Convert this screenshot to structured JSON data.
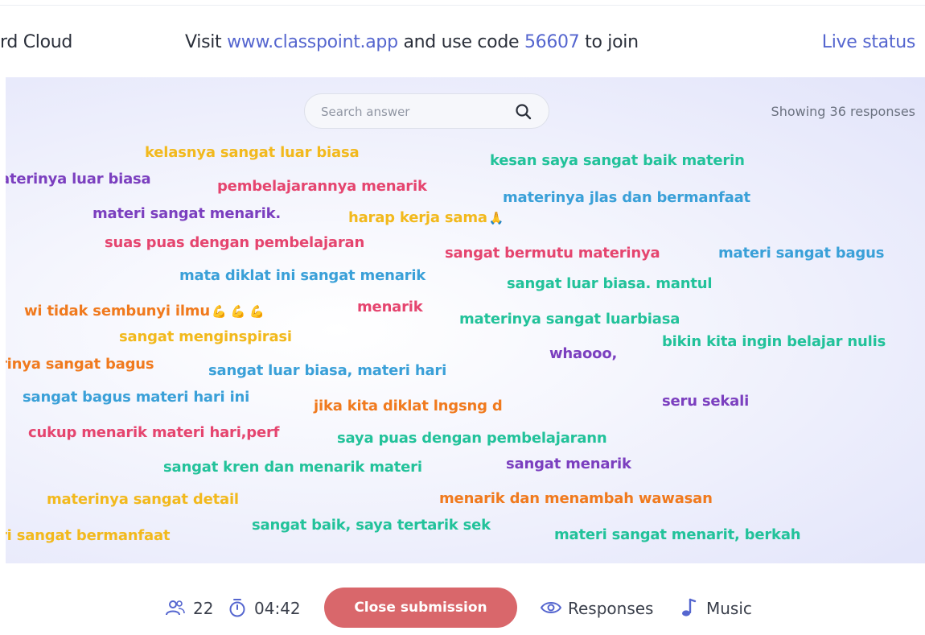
{
  "header": {
    "title": "rd Cloud",
    "join_prefix": "Visit ",
    "join_url": "www.classpoint.app",
    "join_mid": " and use code ",
    "join_code": "56607",
    "join_suffix": " to join",
    "live_status": "Live status"
  },
  "search": {
    "placeholder": "Search answer",
    "value": ""
  },
  "showing": "Showing 36 responses",
  "responses": [
    "kelasnya sangat luar biasa",
    "kesan saya sangat baik materin",
    "aterinya luar biasa",
    "pembelajarannya menarik",
    "materinya jlas dan bermanfaat",
    "materi sangat menarik.",
    "harap kerja sama",
    "suas puas dengan pembelajaran",
    "sangat bermutu materinya",
    "materi sangat bagus",
    "mata diklat ini sangat menarik",
    "sangat luar biasa. mantul",
    "wi tidak sembunyi ilmu",
    "menarik",
    "materinya sangat luarbiasa",
    "sangat menginspirasi",
    "bikin kita ingin belajar nulis",
    "whaooo,",
    "rinya sangat bagus",
    "sangat luar biasa, materi hari",
    "sangat bagus materi hari ini",
    "jika kita diklat lngsng d",
    "seru sekali",
    "cukup menarik materi hari,perf",
    "saya puas dengan pembelajarann",
    "sangat kren dan menarik materi",
    "sangat menarik",
    "materinya sangat detail",
    "menarik dan menambah wawasan",
    "sangat baik, saya tertarik sek",
    "ri sangat bermanfaat",
    "materi sangat menarit, berkah"
  ],
  "emojis": {
    "pray": "🙏",
    "muscle": "💪 💪 💪"
  },
  "footer": {
    "participants": "22",
    "timer": "04:42",
    "close_label": "Close submission",
    "responses_label": "Responses",
    "music_label": "Music"
  },
  "colors": {
    "accent": "#5566cf",
    "close_button": "#d9676b",
    "yellow": "#f2b91d",
    "teal": "#22c29a",
    "purple": "#7b3fbf",
    "pink": "#e5456f",
    "blue": "#3aa0d8",
    "orange": "#f07a1e"
  },
  "icons": [
    "search-icon",
    "users-icon",
    "timer-icon",
    "eye-icon",
    "music-note-icon"
  ]
}
